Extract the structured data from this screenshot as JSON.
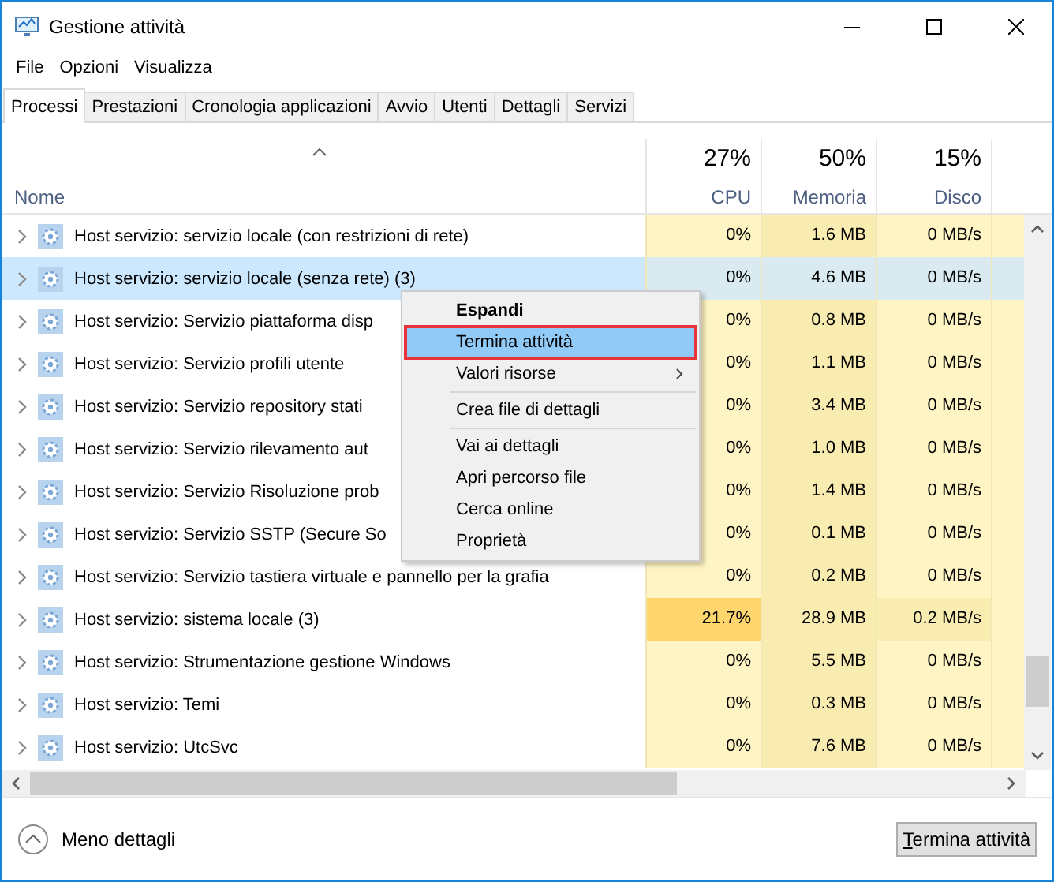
{
  "window": {
    "title": "Gestione attività"
  },
  "menu_bar": [
    "File",
    "Opzioni",
    "Visualizza"
  ],
  "tabs": [
    {
      "label": "Processi",
      "selected": true
    },
    {
      "label": "Prestazioni",
      "selected": false
    },
    {
      "label": "Cronologia applicazioni",
      "selected": false
    },
    {
      "label": "Avvio",
      "selected": false
    },
    {
      "label": "Utenti",
      "selected": false
    },
    {
      "label": "Dettagli",
      "selected": false
    },
    {
      "label": "Servizi",
      "selected": false
    }
  ],
  "table": {
    "columns": [
      {
        "label": "Nome"
      },
      {
        "label": "CPU",
        "usage": "27%"
      },
      {
        "label": "Memoria",
        "usage": "50%"
      },
      {
        "label": "Disco",
        "usage": "15%"
      }
    ],
    "rows": [
      {
        "name": "Host servizio: servizio locale (con restrizioni di rete)",
        "selected": false,
        "cpu": {
          "text": "0%",
          "color": "#fff4c4"
        },
        "memory": {
          "text": "1.6 MB",
          "color": "#f9ecb0"
        },
        "disk": {
          "text": "0 MB/s",
          "color": "#fff4c4"
        }
      },
      {
        "name": "Host servizio: servizio locale (senza rete) (3)",
        "selected": true,
        "cpu": {
          "text": "0%",
          "color": "#d9eaf0"
        },
        "memory": {
          "text": "4.6 MB",
          "color": "#d9eaf0"
        },
        "disk": {
          "text": "0 MB/s",
          "color": "#d9eaf0"
        }
      },
      {
        "name": "Host servizio: Servizio piattaforma disp",
        "selected": false,
        "cpu": {
          "text": "0%",
          "color": "#fff4c4"
        },
        "memory": {
          "text": "0.8 MB",
          "color": "#f9ecb0"
        },
        "disk": {
          "text": "0 MB/s",
          "color": "#fff4c4"
        }
      },
      {
        "name": "Host servizio: Servizio profili utente",
        "selected": false,
        "cpu": {
          "text": "0%",
          "color": "#fff4c4"
        },
        "memory": {
          "text": "1.1 MB",
          "color": "#f9ecb0"
        },
        "disk": {
          "text": "0 MB/s",
          "color": "#fff4c4"
        }
      },
      {
        "name": "Host servizio: Servizio repository stati",
        "selected": false,
        "cpu": {
          "text": "0%",
          "color": "#fff4c4"
        },
        "memory": {
          "text": "3.4 MB",
          "color": "#f9ecb0"
        },
        "disk": {
          "text": "0 MB/s",
          "color": "#fff4c4"
        }
      },
      {
        "name": "Host servizio: Servizio rilevamento aut",
        "selected": false,
        "cpu": {
          "text": "0%",
          "color": "#fff4c4"
        },
        "memory": {
          "text": "1.0 MB",
          "color": "#f9ecb0"
        },
        "disk": {
          "text": "0 MB/s",
          "color": "#fff4c4"
        }
      },
      {
        "name": "Host servizio: Servizio Risoluzione prob",
        "selected": false,
        "cpu": {
          "text": "0%",
          "color": "#fff4c4"
        },
        "memory": {
          "text": "1.4 MB",
          "color": "#f9ecb0"
        },
        "disk": {
          "text": "0 MB/s",
          "color": "#fff4c4"
        }
      },
      {
        "name": "Host servizio: Servizio SSTP (Secure So",
        "selected": false,
        "cpu": {
          "text": "0%",
          "color": "#fff4c4"
        },
        "memory": {
          "text": "0.1 MB",
          "color": "#f9ecb0"
        },
        "disk": {
          "text": "0 MB/s",
          "color": "#fff4c4"
        }
      },
      {
        "name": "Host servizio: Servizio tastiera virtuale e pannello per la grafia",
        "selected": false,
        "cpu": {
          "text": "0%",
          "color": "#fff4c4"
        },
        "memory": {
          "text": "0.2 MB",
          "color": "#f9ecb0"
        },
        "disk": {
          "text": "0 MB/s",
          "color": "#fff4c4"
        }
      },
      {
        "name": "Host servizio: sistema locale (3)",
        "selected": false,
        "cpu": {
          "text": "21.7%",
          "color": "#ffd66e"
        },
        "memory": {
          "text": "28.9 MB",
          "color": "#f9ecb0"
        },
        "disk": {
          "text": "0.2 MB/s",
          "color": "#f9ecb0"
        }
      },
      {
        "name": "Host servizio: Strumentazione gestione Windows",
        "selected": false,
        "cpu": {
          "text": "0%",
          "color": "#fff4c4"
        },
        "memory": {
          "text": "5.5 MB",
          "color": "#f9ecb0"
        },
        "disk": {
          "text": "0 MB/s",
          "color": "#fff4c4"
        }
      },
      {
        "name": "Host servizio: Temi",
        "selected": false,
        "cpu": {
          "text": "0%",
          "color": "#fff4c4"
        },
        "memory": {
          "text": "0.3 MB",
          "color": "#f9ecb0"
        },
        "disk": {
          "text": "0 MB/s",
          "color": "#fff4c4"
        }
      },
      {
        "name": "Host servizio: UtcSvc",
        "selected": false,
        "cpu": {
          "text": "0%",
          "color": "#fff4c4"
        },
        "memory": {
          "text": "7.6 MB",
          "color": "#f9ecb0"
        },
        "disk": {
          "text": "0 MB/s",
          "color": "#fff4c4"
        }
      }
    ]
  },
  "context_menu": {
    "items": [
      {
        "kind": "default",
        "label": "Espandi",
        "selected": false
      },
      {
        "kind": "command",
        "label": "Termina attività",
        "selected": true
      },
      {
        "kind": "submenu",
        "label": "Valori risorse",
        "selected": false
      },
      {
        "kind": "separator"
      },
      {
        "kind": "command",
        "label": "Crea file di dettagli",
        "selected": false
      },
      {
        "kind": "separator"
      },
      {
        "kind": "command",
        "label": "Vai ai dettagli",
        "selected": false
      },
      {
        "kind": "command",
        "label": "Apri percorso file",
        "selected": false
      },
      {
        "kind": "command",
        "label": "Cerca online",
        "selected": false
      },
      {
        "kind": "command",
        "label": "Proprietà",
        "selected": false
      }
    ]
  },
  "footer": {
    "toggle": "Meno dettagli",
    "button": "Termina attività"
  }
}
